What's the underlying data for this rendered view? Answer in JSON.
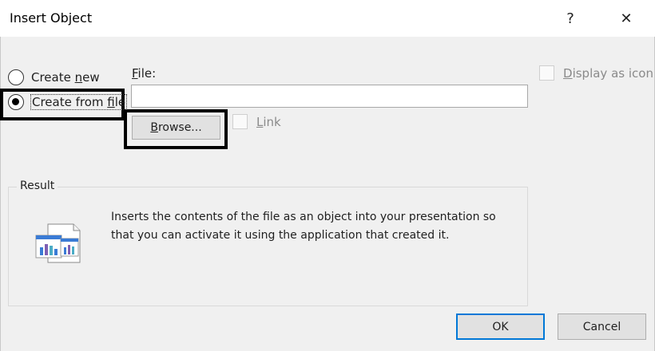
{
  "dialog": {
    "title": "Insert Object",
    "help_glyph": "?",
    "close_glyph": "✕"
  },
  "source": {
    "create_new_pre": "Create ",
    "create_new_key": "n",
    "create_new_post": "ew",
    "create_from_file_pre": "Create from ",
    "create_from_file_key": "f",
    "create_from_file_post": "ile",
    "selected": "create_from_file"
  },
  "file": {
    "label_key": "F",
    "label_post": "ile:",
    "value": "",
    "browse_key": "B",
    "browse_post": "rowse..."
  },
  "link": {
    "label_key": "L",
    "label_post": "ink",
    "checked": false
  },
  "display_as_icon": {
    "label_key": "D",
    "label_post": "isplay as icon",
    "checked": false
  },
  "result": {
    "legend": "Result",
    "text": "Inserts the contents of the file as an object into your presentation so that you can activate it using the application that created it."
  },
  "buttons": {
    "ok": "OK",
    "cancel": "Cancel"
  },
  "colors": {
    "accent": "#0078d7",
    "highlight_border": "#000000"
  }
}
